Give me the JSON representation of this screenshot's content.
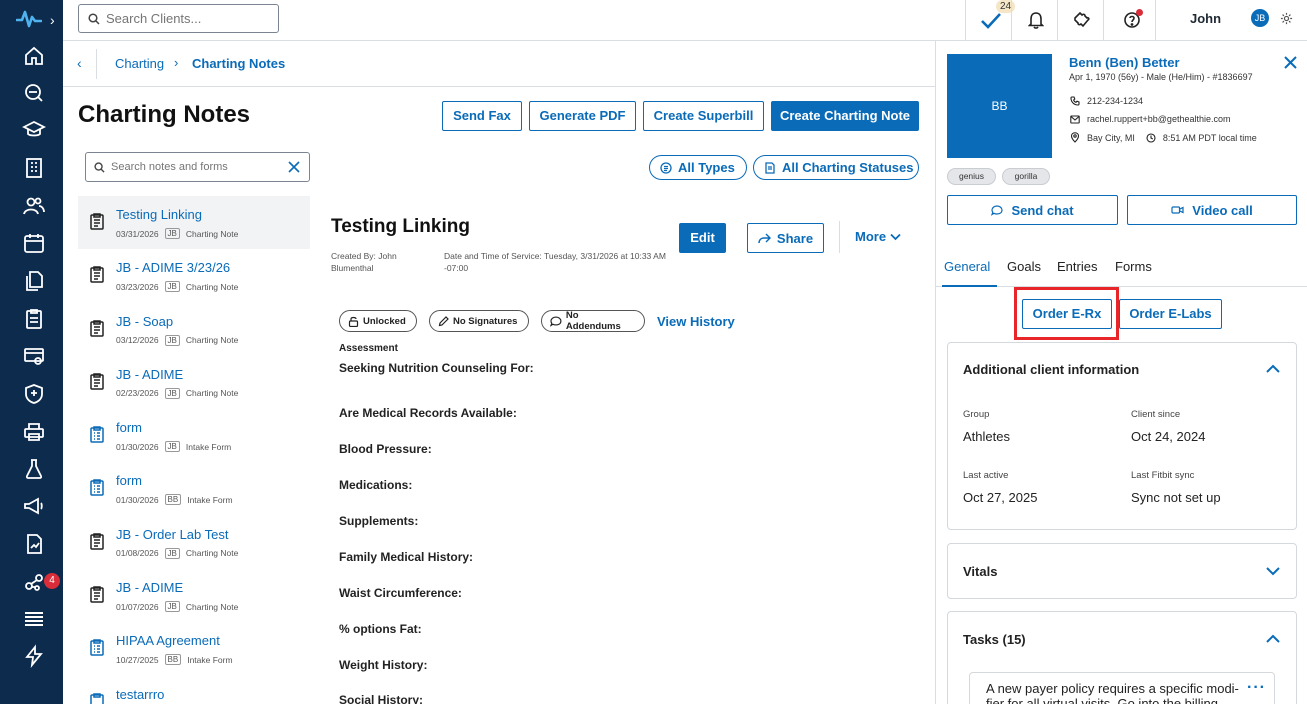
{
  "topbar": {
    "search_placeholder": "Search Clients...",
    "tasks_count": "24",
    "user_name": "John",
    "user_initials": "JB"
  },
  "rail": {
    "badge_count": "4"
  },
  "breadcrumb": {
    "parent": "Charting",
    "current": "Charting Notes"
  },
  "header": {
    "title": "Charting Notes",
    "send_fax": "Send Fax",
    "generate_pdf": "Generate PDF",
    "create_superbill": "Create Superbill",
    "create_note": "Create Charting Note"
  },
  "filters": {
    "search_placeholder": "Search notes and forms",
    "all_types": "All Types",
    "all_statuses": "All Charting Statuses"
  },
  "notes": [
    {
      "title": "Testing Linking",
      "date": "03/31/2026",
      "initials": "JB",
      "type": "Charting Note"
    },
    {
      "title": "JB - ADIME 3/23/26",
      "date": "03/23/2026",
      "initials": "JB",
      "type": "Charting Note"
    },
    {
      "title": "JB - Soap",
      "date": "03/12/2026",
      "initials": "JB",
      "type": "Charting Note"
    },
    {
      "title": "JB - ADIME",
      "date": "02/23/2026",
      "initials": "JB",
      "type": "Charting Note"
    },
    {
      "title": "form",
      "date": "01/30/2026",
      "initials": "JB",
      "type": "Intake Form"
    },
    {
      "title": "form",
      "date": "01/30/2026",
      "initials": "BB",
      "type": "Intake Form"
    },
    {
      "title": "JB - Order Lab Test",
      "date": "01/08/2026",
      "initials": "JB",
      "type": "Charting Note"
    },
    {
      "title": "JB - ADIME",
      "date": "01/07/2026",
      "initials": "JB",
      "type": "Charting Note"
    },
    {
      "title": "HIPAA Agreement",
      "date": "10/27/2025",
      "initials": "BB",
      "type": "Intake Form"
    },
    {
      "title": "testarrro",
      "date": "",
      "initials": "",
      "type": ""
    }
  ],
  "detail": {
    "title": "Testing Linking",
    "edit": "Edit",
    "share": "Share",
    "more": "More",
    "created_by": "Created By: John Blumenthal",
    "date_of_service": "Date and Time of Service: Tuesday, 3/31/2026 at 10:33 AM -07:00",
    "chip_unlocked": "Unlocked",
    "chip_signatures": "No Signatures",
    "chip_addendums": "No Addendums",
    "view_history": "View History",
    "section": "Assessment",
    "fields": [
      "Seeking Nutrition Counseling For:",
      "Are Medical Records Available:",
      "Blood Pressure:",
      "Medications:",
      "Supplements:",
      "Family Medical History:",
      "Waist Circumference:",
      "% options Fat:",
      "Weight History:",
      "Social History:"
    ]
  },
  "client": {
    "initials": "BB",
    "name": "Benn (Ben) Better",
    "dob": "Apr 1, 1970 (56y) - Male (He/Him) - #1836697",
    "phone": "212-234-1234",
    "email": "rachel.ruppert+bb@gethealthie.com",
    "location": "Bay City, MI",
    "local_time": "8:51 AM PDT local time",
    "tags": [
      "genius",
      "gorilla"
    ],
    "send_chat": "Send chat",
    "video_call": "Video call"
  },
  "right_tabs": [
    "General",
    "Goals",
    "Entries",
    "Forms"
  ],
  "orders": {
    "erx": "Order E-Rx",
    "elabs": "Order E-Labs"
  },
  "additional_info": {
    "title": "Additional client information",
    "group_label": "Group",
    "group_value": "Athletes",
    "since_label": "Client since",
    "since_value": "Oct 24, 2024",
    "active_label": "Last active",
    "active_value": "Oct 27, 2025",
    "fitbit_label": "Last Fitbit sync",
    "fitbit_value": "Sync not set up"
  },
  "vitals": {
    "title": "Vitals"
  },
  "tasks": {
    "title": "Tasks (15)",
    "first_task": "A new payer policy requires a specific modi-fier for all virtual visits. Go into the billing"
  },
  "colors": {
    "rail": "#0d2b4d",
    "accent": "#0a6bb8",
    "highlight": "#e8262a"
  }
}
